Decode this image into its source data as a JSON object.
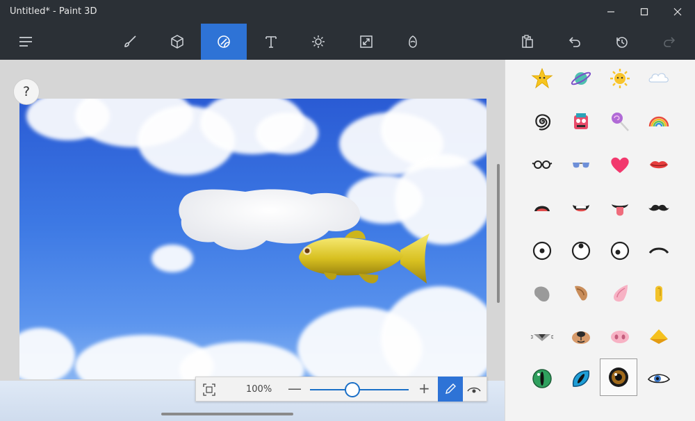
{
  "window": {
    "title": "Untitled* - Paint 3D",
    "controls": [
      "minimize",
      "maximize",
      "close"
    ]
  },
  "toolbar": {
    "menu_icon": "hamburger-icon",
    "tools": [
      {
        "name": "brushes",
        "icon": "brush-icon"
      },
      {
        "name": "3d-shapes",
        "icon": "cube-icon"
      },
      {
        "name": "stickers",
        "icon": "sticker-icon",
        "active": true
      },
      {
        "name": "text",
        "icon": "text-icon"
      },
      {
        "name": "effects",
        "icon": "sun-icon"
      },
      {
        "name": "canvas",
        "icon": "resize-icon"
      },
      {
        "name": "3d-library",
        "icon": "library-icon"
      }
    ],
    "actions": [
      "paste-icon",
      "undo-icon",
      "history-icon",
      "redo-icon"
    ]
  },
  "workspace": {
    "help_label": "?",
    "canvas_content": "sky-with-clouds-and-gold-fish"
  },
  "zoombar": {
    "zoom_value": "100%",
    "minus_label": "—",
    "plus_label": "+",
    "zoom_level": 0.43
  },
  "stickers": {
    "selected_index": 30,
    "items": [
      "star-sticker",
      "planet-sticker",
      "sun-sticker",
      "cloud-sticker",
      "spiral-sticker",
      "robot-face-sticker",
      "lollipop-sticker",
      "rainbow-sticker",
      "glasses-sticker",
      "sunglasses-sticker",
      "heart-sticker",
      "lips-sticker",
      "open-mouth-sticker",
      "smile-mouth-sticker",
      "tongue-mouth-sticker",
      "mustache-sticker",
      "eye-center-sticker",
      "eye-up-sticker",
      "eye-side-sticker",
      "eyebrow-sticker",
      "grey-ear-sticker",
      "brown-ear-sticker",
      "pink-ear-sticker",
      "yellow-ear-sticker",
      "grey-nose-sticker",
      "dog-nose-sticker",
      "pig-nose-sticker",
      "beak-sticker",
      "green-eye-sticker",
      "cat-eye-sticker",
      "brown-eye-sticker",
      "blue-eye-sticker"
    ]
  },
  "colors": {
    "accent": "#2e73d6",
    "titlebar": "#2b3036",
    "panel": "#f3f3f3"
  }
}
